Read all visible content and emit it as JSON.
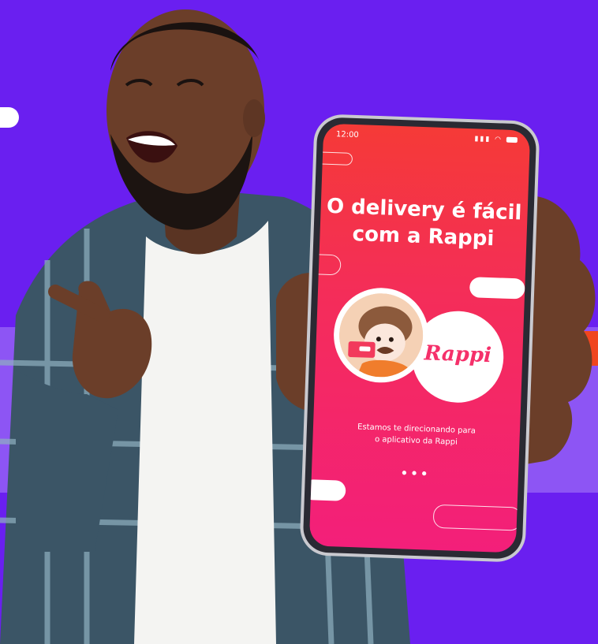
{
  "phone": {
    "status_time": "12:00",
    "headline_line1": "O delivery é fácil",
    "headline_line2": "com a Rappi",
    "brand": "Rappi",
    "subtext_line1": "Estamos te direcionando para",
    "subtext_line2": "o aplicativo da Rappi",
    "loading_dots": "•••"
  },
  "colors": {
    "background": "#6a1ff0",
    "band": "#8d55f4",
    "screen_top": "#f53a37",
    "screen_bottom": "#f31f7a",
    "brand": "#f5306a"
  }
}
